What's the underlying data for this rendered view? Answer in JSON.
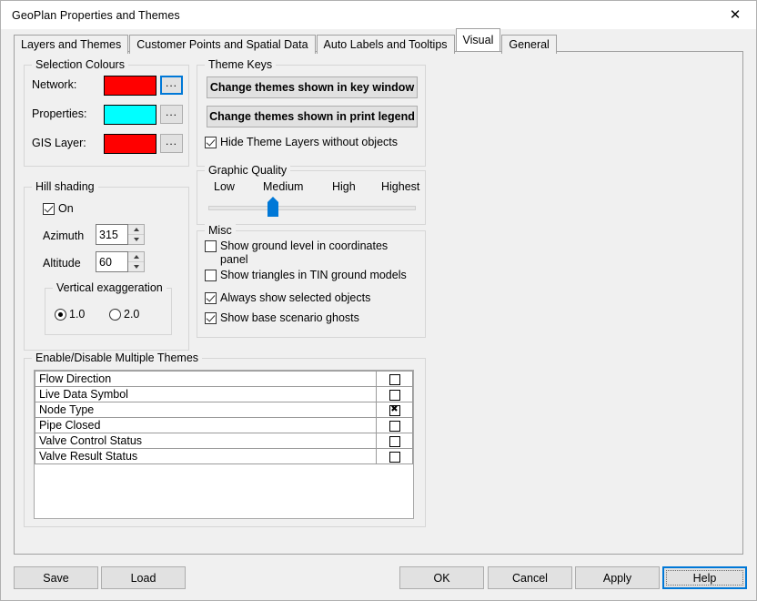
{
  "window": {
    "title": "GeoPlan Properties and Themes",
    "close_icon": "close-icon"
  },
  "tabs": [
    {
      "label": "Layers and Themes",
      "active": false
    },
    {
      "label": "Customer Points and Spatial Data",
      "active": false
    },
    {
      "label": "Auto Labels and Tooltips",
      "active": false
    },
    {
      "label": "Visual",
      "active": true
    },
    {
      "label": "General",
      "active": false
    }
  ],
  "selection_colours": {
    "title": "Selection Colours",
    "rows": [
      {
        "label": "Network:",
        "color": "#FF0000",
        "button": "...",
        "focused": true
      },
      {
        "label": "Properties:",
        "color": "#00FFFF",
        "button": "...",
        "focused": false
      },
      {
        "label": "GIS Layer:",
        "color": "#FF0000",
        "button": "...",
        "focused": false
      }
    ]
  },
  "hill_shading": {
    "title": "Hill shading",
    "on_label": "On",
    "on_checked": true,
    "azimuth_label": "Azimuth",
    "azimuth_value": "315",
    "altitude_label": "Altitude",
    "altitude_value": "60",
    "vertical_exaggeration": {
      "title": "Vertical exaggeration",
      "options": [
        {
          "label": "1.0",
          "selected": true
        },
        {
          "label": "2.0",
          "selected": false
        }
      ]
    }
  },
  "theme_keys": {
    "title": "Theme Keys",
    "key_window_button": "Change themes shown in key window",
    "print_legend_button": "Change themes shown in print legend",
    "hide_layers_label": "Hide Theme Layers without objects",
    "hide_layers_checked": true
  },
  "graphic_quality": {
    "title": "Graphic Quality",
    "ticks": [
      "Low",
      "Medium",
      "High",
      "Highest"
    ],
    "selected": "Medium",
    "slider_position_percent": 31
  },
  "misc": {
    "title": "Misc",
    "items": [
      {
        "label": "Show ground level in coordinates panel",
        "checked": false
      },
      {
        "label": "Show triangles in TIN ground models",
        "checked": false
      },
      {
        "label": "Always show selected objects",
        "checked": true
      },
      {
        "label": "Show base scenario ghosts",
        "checked": true
      }
    ]
  },
  "themes": {
    "title": "Enable/Disable Multiple Themes",
    "rows": [
      {
        "name": "Flow Direction",
        "enabled": false
      },
      {
        "name": "Live Data Symbol",
        "enabled": false
      },
      {
        "name": "Node Type",
        "enabled": true
      },
      {
        "name": "Pipe Closed",
        "enabled": false
      },
      {
        "name": "Valve Control Status",
        "enabled": false
      },
      {
        "name": "Valve Result Status",
        "enabled": false
      }
    ]
  },
  "buttons": {
    "save": "Save",
    "load": "Load",
    "ok": "OK",
    "cancel": "Cancel",
    "apply": "Apply",
    "help": "Help"
  },
  "colors": {
    "accent": "#0078D7",
    "dialog_bg": "#F0F0F0",
    "button_face": "#E1E1E1"
  }
}
